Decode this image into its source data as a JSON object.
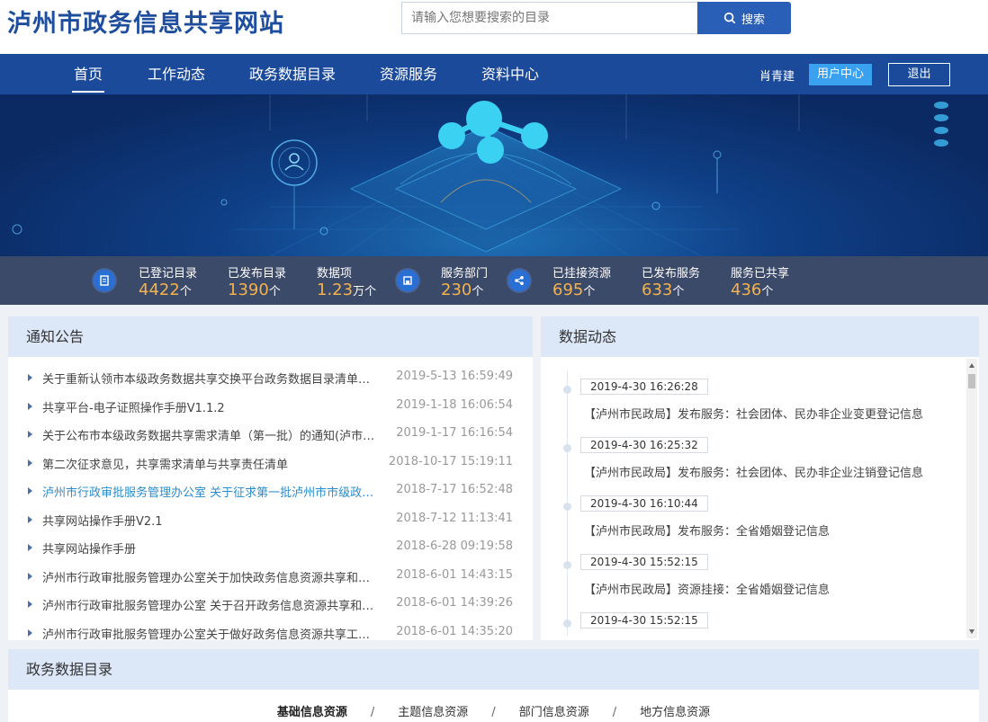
{
  "header": {
    "site_title": "泸州市政务信息共享网站",
    "search_placeholder": "请输入您想要搜索的目录",
    "search_button": "搜索"
  },
  "nav": {
    "items": [
      "首页",
      "工作动态",
      "政务数据目录",
      "资源服务",
      "资料中心"
    ],
    "active_index": 0,
    "user_name": "肖青建",
    "user_center": "用户中心",
    "logout": "退出"
  },
  "stats": [
    {
      "label": "已登记目录",
      "value": "4422",
      "unit": "个"
    },
    {
      "label": "已发布目录",
      "value": "1390",
      "unit": "个"
    },
    {
      "label": "数据项",
      "value": "1.23",
      "unit": "万个"
    },
    {
      "label": "服务部门",
      "value": "230",
      "unit": "个"
    },
    {
      "label": "已挂接资源",
      "value": "695",
      "unit": "个"
    },
    {
      "label": "已发布服务",
      "value": "633",
      "unit": "个"
    },
    {
      "label": "服务已共享",
      "value": "436",
      "unit": "个"
    }
  ],
  "notice": {
    "title": "通知公告",
    "items": [
      {
        "title": "关于重新认领市本级政务数据共享交换平台政务数据目录清单的函",
        "date": "2019-5-13 16:59:49"
      },
      {
        "title": "共享平台-电子证照操作手册V1.1.2",
        "date": "2019-1-18 16:06:54"
      },
      {
        "title": "关于公布市本级政务数据共享需求清单（第一批）的通知(泸市府...",
        "date": "2019-1-17 16:16:54"
      },
      {
        "title": "第二次征求意见，共享需求清单与共享责任清单",
        "date": "2018-10-17 15:19:11"
      },
      {
        "title": "泸州市行政审批服务管理办公室 关于征求第一批泸州市市级政务...",
        "date": "2018-7-17 16:52:48"
      },
      {
        "title": "共享网站操作手册V2.1",
        "date": "2018-7-12 11:13:41"
      },
      {
        "title": "共享网站操作手册",
        "date": "2018-6-28 09:19:58"
      },
      {
        "title": "泸州市行政审批服务管理办公室关于加快政务信息资源共享和应...",
        "date": "2018-6-01 14:43:15"
      },
      {
        "title": "泸州市行政审批服务管理办公室 关于召开政务信息资源共享和应...",
        "date": "2018-6-01 14:39:26"
      },
      {
        "title": "泸州市行政审批服务管理办公室关于做好政务信息资源共享工作...",
        "date": "2018-6-01 14:35:20"
      }
    ],
    "highlight_index": 4
  },
  "dynamics": {
    "title": "数据动态",
    "items": [
      {
        "time": "2019-4-30 16:26:28",
        "text": "【泸州市民政局】发布服务：社会团体、民办非企业变更登记信息"
      },
      {
        "time": "2019-4-30 16:25:32",
        "text": "【泸州市民政局】发布服务：社会团体、民办非企业注销登记信息"
      },
      {
        "time": "2019-4-30 16:10:44",
        "text": "【泸州市民政局】发布服务：全省婚姻登记信息"
      },
      {
        "time": "2019-4-30 15:52:15",
        "text": "【泸州市民政局】资源挂接：全省婚姻登记信息"
      },
      {
        "time": "2019-4-30 15:52:15",
        "text": ""
      }
    ]
  },
  "catalog": {
    "title": "政务数据目录",
    "tabs": [
      "基础信息资源",
      "主题信息资源",
      "部门信息资源",
      "地方信息资源"
    ],
    "separator": "/",
    "active_index": 0
  },
  "colors": {
    "brand_blue": "#1b4a9a",
    "title_blue": "#1f4e9e",
    "stat_orange": "#f3b24c",
    "link_highlight": "#2a8ccd"
  }
}
